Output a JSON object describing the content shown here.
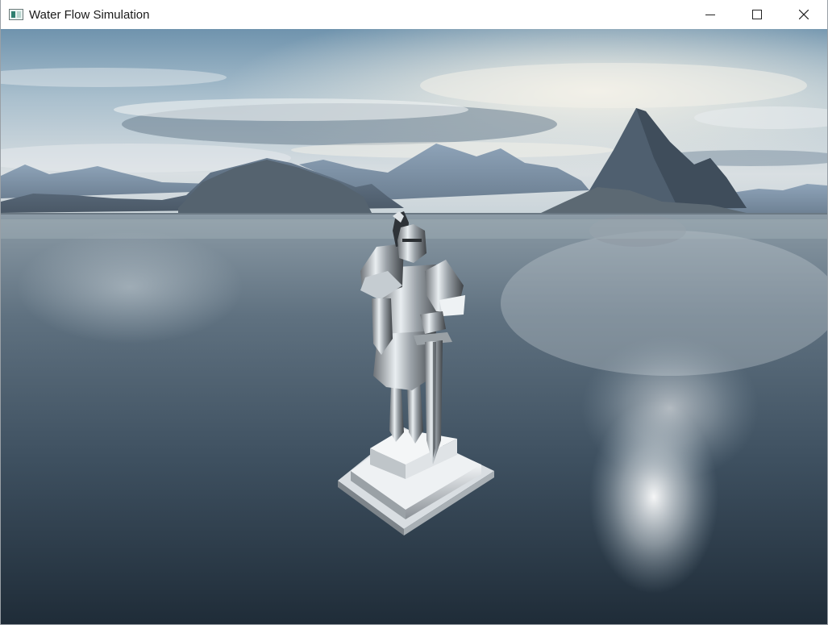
{
  "window": {
    "title": "Water Flow Simulation",
    "icon": "app-window-icon",
    "controls": [
      "minimize-icon",
      "maximize-icon",
      "close-icon"
    ]
  },
  "scene": {
    "elements": [
      "sky",
      "clouds",
      "mountains",
      "water",
      "knight-statue",
      "pedestal"
    ]
  }
}
